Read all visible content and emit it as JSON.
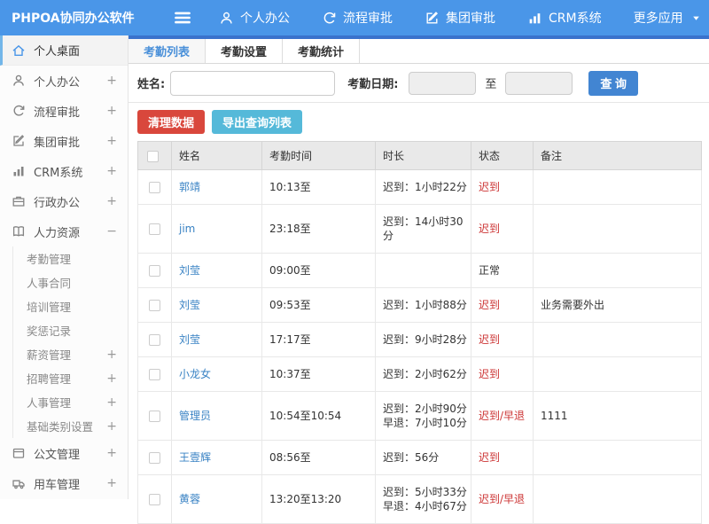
{
  "app": {
    "title": "PHPOA协同办公软件"
  },
  "topnav": {
    "items": [
      {
        "key": "personal-office",
        "label": "个人办公",
        "icon": "person-icon"
      },
      {
        "key": "workflow-approval",
        "label": "流程审批",
        "icon": "flow-icon"
      },
      {
        "key": "group-approval",
        "label": "集团审批",
        "icon": "edit-icon"
      },
      {
        "key": "crm-system",
        "label": "CRM系统",
        "icon": "chart-icon"
      },
      {
        "key": "more-apps",
        "label": "更多应用",
        "icon": "",
        "chevron": true
      }
    ]
  },
  "sidebar": {
    "items": [
      {
        "key": "personal-desktop",
        "label": "个人桌面",
        "icon": "home-icon",
        "suffix": "",
        "active": true
      },
      {
        "key": "personal-office",
        "label": "个人办公",
        "icon": "person-icon",
        "suffix": "+"
      },
      {
        "key": "workflow-approval",
        "label": "流程审批",
        "icon": "flow-icon",
        "suffix": "+"
      },
      {
        "key": "group-approval",
        "label": "集团审批",
        "icon": "edit-icon",
        "suffix": "+"
      },
      {
        "key": "crm-system",
        "label": "CRM系统",
        "icon": "chart-icon",
        "suffix": "+"
      },
      {
        "key": "admin-office",
        "label": "行政办公",
        "icon": "briefcase-icon",
        "suffix": "+"
      },
      {
        "key": "human-resources",
        "label": "人力资源",
        "icon": "book-icon",
        "suffix": "−"
      },
      {
        "key": "attendance-management",
        "label": "考勤管理",
        "sub": true,
        "suffix": ""
      },
      {
        "key": "personnel-contract",
        "label": "人事合同",
        "sub": true,
        "suffix": ""
      },
      {
        "key": "training-management",
        "label": "培训管理",
        "sub": true,
        "suffix": ""
      },
      {
        "key": "reward-punishment",
        "label": "奖惩记录",
        "sub": true,
        "suffix": ""
      },
      {
        "key": "salary-management",
        "label": "薪资管理",
        "sub": true,
        "suffix": "+"
      },
      {
        "key": "recruitment-management",
        "label": "招聘管理",
        "sub": true,
        "suffix": "+"
      },
      {
        "key": "personnel-management",
        "label": "人事管理",
        "sub": true,
        "suffix": "+"
      },
      {
        "key": "basic-category-settings",
        "label": "基础类别设置",
        "sub": true,
        "suffix": "+"
      },
      {
        "key": "document-management",
        "label": "公文管理",
        "icon": "doc-icon",
        "suffix": "+"
      },
      {
        "key": "vehicle-management",
        "label": "用车管理",
        "icon": "truck-icon",
        "suffix": "+"
      }
    ]
  },
  "tabs": [
    {
      "key": "attendance-list",
      "label": "考勤列表",
      "active": true
    },
    {
      "key": "attendance-settings",
      "label": "考勤设置"
    },
    {
      "key": "attendance-statistics",
      "label": "考勤统计"
    }
  ],
  "filter": {
    "name_label": "姓名:",
    "name_value": "",
    "date_label": "考勤日期:",
    "date_from": "",
    "date_to": "",
    "to_label": "至",
    "search_label": "查 询"
  },
  "actions": {
    "clean_label": "清理数据",
    "export_label": "导出查询列表"
  },
  "table": {
    "columns": [
      "姓名",
      "考勤时间",
      "时长",
      "状态",
      "备注"
    ],
    "rows": [
      {
        "name": "郭靖",
        "time": "10:13至",
        "duration": [
          "迟到：1小时22分"
        ],
        "status": "迟到",
        "status_red": true,
        "remark": ""
      },
      {
        "name": "jim",
        "time": "23:18至",
        "duration": [
          "迟到：14小时30分"
        ],
        "status": "迟到",
        "status_red": true,
        "remark": ""
      },
      {
        "name": "刘莹",
        "time": "09:00至",
        "duration": [],
        "status": "正常",
        "status_red": false,
        "remark": ""
      },
      {
        "name": "刘莹",
        "time": "09:53至",
        "duration": [
          "迟到：1小时88分"
        ],
        "status": "迟到",
        "status_red": true,
        "remark": "业务需要外出"
      },
      {
        "name": "刘莹",
        "time": "17:17至",
        "duration": [
          "迟到：9小时28分"
        ],
        "status": "迟到",
        "status_red": true,
        "remark": ""
      },
      {
        "name": "小龙女",
        "time": "10:37至",
        "duration": [
          "迟到：2小时62分"
        ],
        "status": "迟到",
        "status_red": true,
        "remark": ""
      },
      {
        "name": "管理员",
        "time": "10:54至10:54",
        "duration": [
          "迟到：2小时90分",
          "早退：7小时10分"
        ],
        "status": "迟到/早退",
        "status_red": true,
        "remark": "1111"
      },
      {
        "name": "王壹辉",
        "time": "08:56至",
        "duration": [
          "迟到：56分"
        ],
        "status": "迟到",
        "status_red": true,
        "remark": ""
      },
      {
        "name": "黄蓉",
        "time": "13:20至13:20",
        "duration": [
          "迟到：5小时33分",
          "早退：4小时67分"
        ],
        "status": "迟到/早退",
        "status_red": true,
        "remark": ""
      }
    ]
  },
  "colors": {
    "header_blue": "#4a96e8",
    "strip_blue": "#3a72cc",
    "link_blue": "#3a83c4",
    "active_tab_blue": "#4a90d9",
    "search_button_blue": "#4285d2",
    "danger_red": "#d9473c",
    "info_teal": "#55b9d9",
    "status_red": "#cc3434"
  }
}
